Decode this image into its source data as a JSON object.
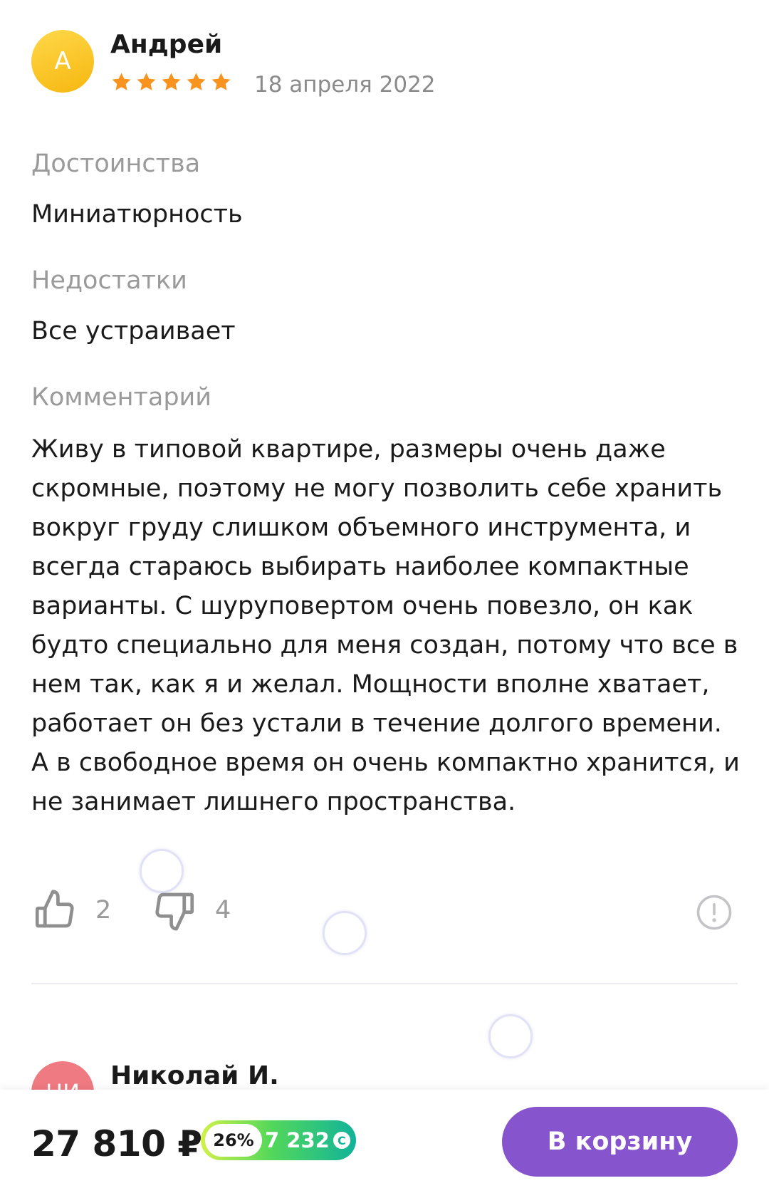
{
  "review": {
    "avatar_letter": "А",
    "author": "Андрей",
    "rating": 5,
    "rating_max": 5,
    "date": "18 апреля 2022",
    "pros_label": "Достоинства",
    "pros_text": "Миниатюрность",
    "cons_label": "Недостатки",
    "cons_text": "Все устраивает",
    "comment_label": "Комментарий",
    "comment_text": "Живу в типовой квартире, размеры очень даже скромные, поэтому не могу позволить себе хранить вокруг груду слишком объемного инструмента, и всегда стараюсь выбирать наиболее компактные варианты. С шуруповертом очень повезло, он как будто специально для меня создан, потому что все в нем так, как я и желал. Мощности вполне хватает, работает он без устали в течение долгого времени. А в свободное время он очень компактно хранится, и не занимает лишнего пространства.",
    "likes": "2",
    "dislikes": "4"
  },
  "next_review": {
    "avatar_letters": "НИ",
    "author": "Николай И."
  },
  "bottom_bar": {
    "price": "27 810 ₽",
    "bonus_percent": "26%",
    "bonus_amount": "7 232",
    "bonus_coin_symbol": "С",
    "cart_button": "В корзину"
  },
  "colors": {
    "accent": "#8654cc",
    "star": "#f7931e",
    "avatar_yellow": "#f6b70f",
    "avatar_pink": "#f07a82",
    "muted_text": "#9a9a9a"
  }
}
